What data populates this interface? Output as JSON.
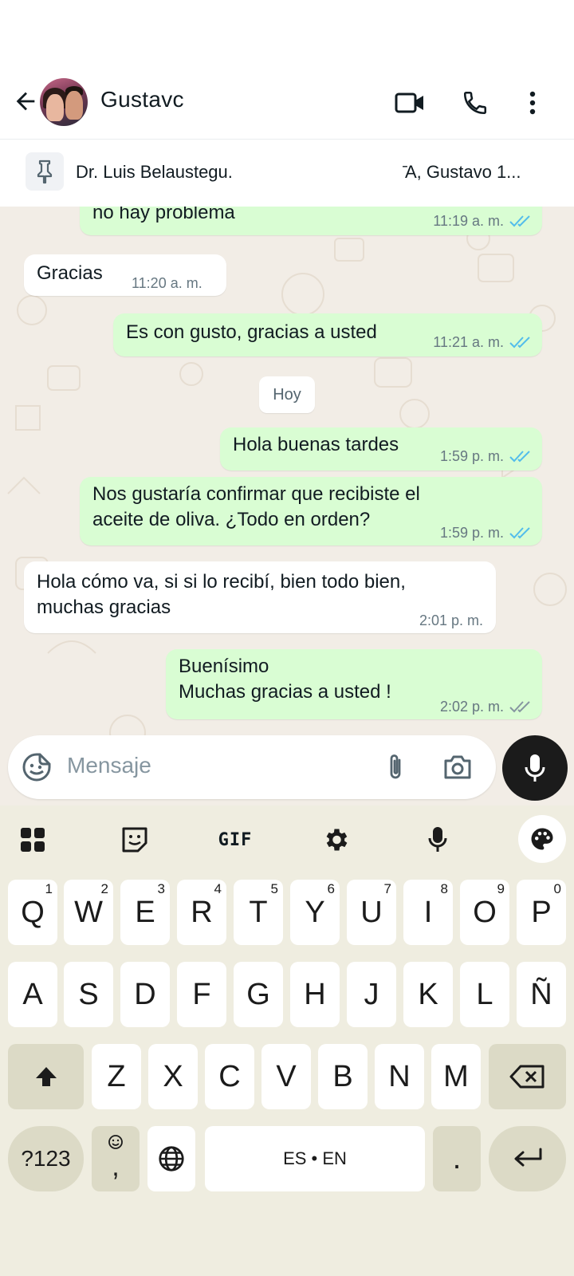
{
  "header": {
    "contact_name": "Gustavc"
  },
  "pinned": {
    "text_left": "Dr. Luis Belaustegu.",
    "text_right": "̄A, Gustavo 1..."
  },
  "chat": {
    "date_chip": "Hoy",
    "messages": [
      {
        "dir": "out",
        "text": "no hay problema",
        "time": "11:19 a. m.",
        "status": "read"
      },
      {
        "dir": "in",
        "text": "Gracias",
        "time": "11:20 a. m."
      },
      {
        "dir": "out",
        "text": "Es con gusto, gracias a usted",
        "time": "11:21 a. m.",
        "status": "read"
      },
      {
        "dir": "out",
        "text": "Hola buenas tardes",
        "time": "1:59 p. m.",
        "status": "read"
      },
      {
        "dir": "out",
        "lines": [
          "Nos gustaría confirmar que recibiste el",
          "aceite de oliva. ¿Todo en orden?"
        ],
        "time": "1:59 p. m.",
        "status": "read"
      },
      {
        "dir": "in",
        "lines": [
          "Hola cómo va, si si lo recibí, bien  todo bien,",
          "muchas gracias"
        ],
        "time": "2:01 p. m."
      },
      {
        "dir": "out",
        "lines": [
          "Buenísimo",
          "Muchas gracias a usted !"
        ],
        "time": "2:02 p. m.",
        "status": "delivered"
      }
    ]
  },
  "input": {
    "placeholder": "Mensaje"
  },
  "keyboard": {
    "toolbar": [
      "apps-grid-icon",
      "sticker-icon",
      "GIF",
      "settings-icon",
      "voice-icon",
      "palette-icon"
    ],
    "gif_label": "GIF",
    "row1": [
      {
        "k": "Q",
        "n": "1"
      },
      {
        "k": "W",
        "n": "2"
      },
      {
        "k": "E",
        "n": "3"
      },
      {
        "k": "R",
        "n": "4"
      },
      {
        "k": "T",
        "n": "5"
      },
      {
        "k": "Y",
        "n": "6"
      },
      {
        "k": "U",
        "n": "7"
      },
      {
        "k": "I",
        "n": "8"
      },
      {
        "k": "O",
        "n": "9"
      },
      {
        "k": "P",
        "n": "0"
      }
    ],
    "row2": [
      "A",
      "S",
      "D",
      "F",
      "G",
      "H",
      "J",
      "K",
      "L",
      "Ñ"
    ],
    "row3": [
      "Z",
      "X",
      "C",
      "V",
      "B",
      "N",
      "M"
    ],
    "symbols_label": "?123",
    "emoji_comma_label": ",",
    "space_label": "ES • EN",
    "period_label": "."
  },
  "colors": {
    "outgoing_bubble": "#d9fdd3",
    "incoming_bubble": "#ffffff",
    "read_tick": "#53bdeb",
    "delivered_tick": "#8696a0",
    "keyboard_bg": "#efede0"
  }
}
